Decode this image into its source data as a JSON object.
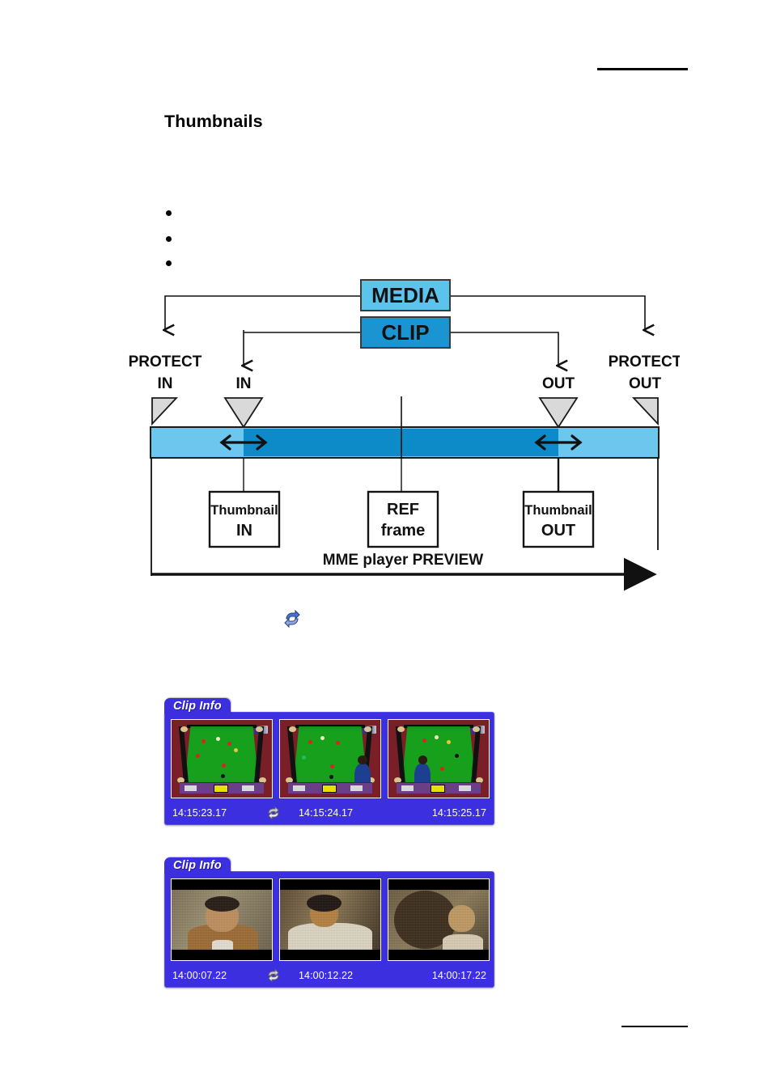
{
  "page": {
    "section_title": "Thumbnails",
    "bullets": [
      "",
      "",
      ""
    ]
  },
  "diagram": {
    "boxes": {
      "media": {
        "label": "MEDIA",
        "color": "#5BC4EC"
      },
      "clip": {
        "label": "CLIP",
        "color": "#1B95D1"
      }
    },
    "markers": [
      {
        "id": "protect-in",
        "line1": "PROTECT",
        "line2": "IN"
      },
      {
        "id": "in",
        "line1": "",
        "line2": "IN"
      },
      {
        "id": "out",
        "line1": "",
        "line2": "OUT"
      },
      {
        "id": "protect-out",
        "line1": "PROTECT",
        "line2": "OUT"
      }
    ],
    "callouts": [
      {
        "id": "thumbnail-in",
        "line1": "Thumbnail",
        "line2": "IN"
      },
      {
        "id": "ref-frame",
        "line1": "REF",
        "line2": "frame"
      },
      {
        "id": "thumbnail-out",
        "line1": "Thumbnail",
        "line2": "OUT"
      }
    ],
    "preview_label": "MME player PREVIEW",
    "timeline_colors": {
      "protect_zone": "#6CC6EE",
      "clip_zone": "#0D8BC9",
      "marker_fill": "#D9D9D9",
      "outline": "#1A1A1A"
    }
  },
  "refresh_icon": {
    "name": "refresh-loop-icon",
    "color": "#3A63C8"
  },
  "clip_panels": [
    {
      "tab_label": "Clip Info",
      "panel_color": "#3B2FE0",
      "loop_icon": "refresh-loop-icon",
      "thumbnails": [
        {
          "kind": "snooker",
          "timecode": "14:15:23.17"
        },
        {
          "kind": "snooker",
          "timecode": "14:15:24.17"
        },
        {
          "kind": "snooker",
          "timecode": "14:15:25.17"
        }
      ]
    },
    {
      "tab_label": "Clip Info",
      "panel_color": "#3B2FE0",
      "loop_icon": "refresh-loop-icon",
      "thumbnails": [
        {
          "kind": "portrait",
          "timecode": "14:00:07.22"
        },
        {
          "kind": "portrait",
          "timecode": "14:00:12.22"
        },
        {
          "kind": "portrait",
          "timecode": "14:00:17.22"
        }
      ]
    }
  ]
}
